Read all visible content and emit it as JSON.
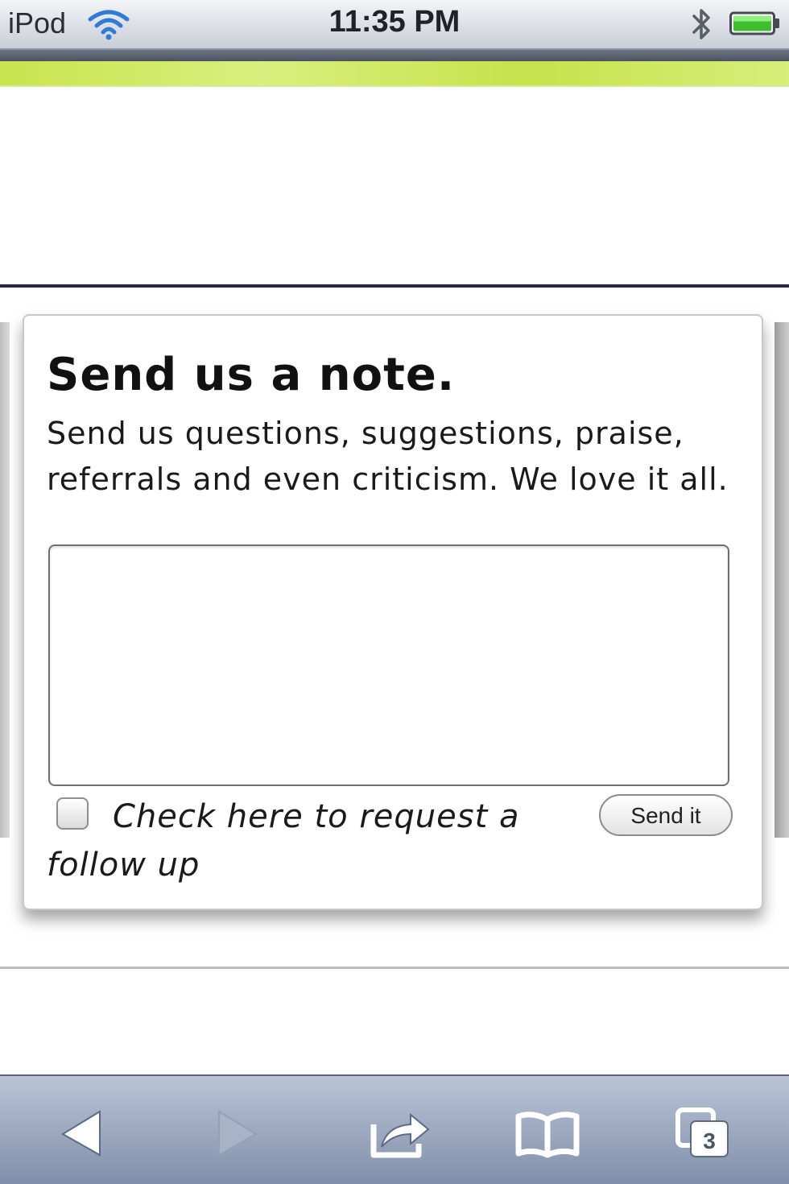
{
  "status_bar": {
    "device": "iPod",
    "time": "11:35 PM",
    "icons": [
      "wifi-icon",
      "bluetooth-icon",
      "battery-icon"
    ]
  },
  "colors": {
    "accent_stripe": "#c9e44e",
    "toolbar": "#8f9db6",
    "divider": "#2a2750"
  },
  "card": {
    "title": "Send us a note.",
    "description": "Send us questions, suggestions, praise, referrals and even criticism. We love it all.",
    "textarea_value": "",
    "checkbox_checked": false,
    "checkbox_label": "Check here to request a follow up",
    "submit_label": "Send it"
  },
  "browser_toolbar": {
    "icons": [
      "back-arrow-icon",
      "forward-arrow-icon",
      "share-icon",
      "bookmarks-icon",
      "tabs-icon"
    ],
    "tab_count": "3"
  }
}
